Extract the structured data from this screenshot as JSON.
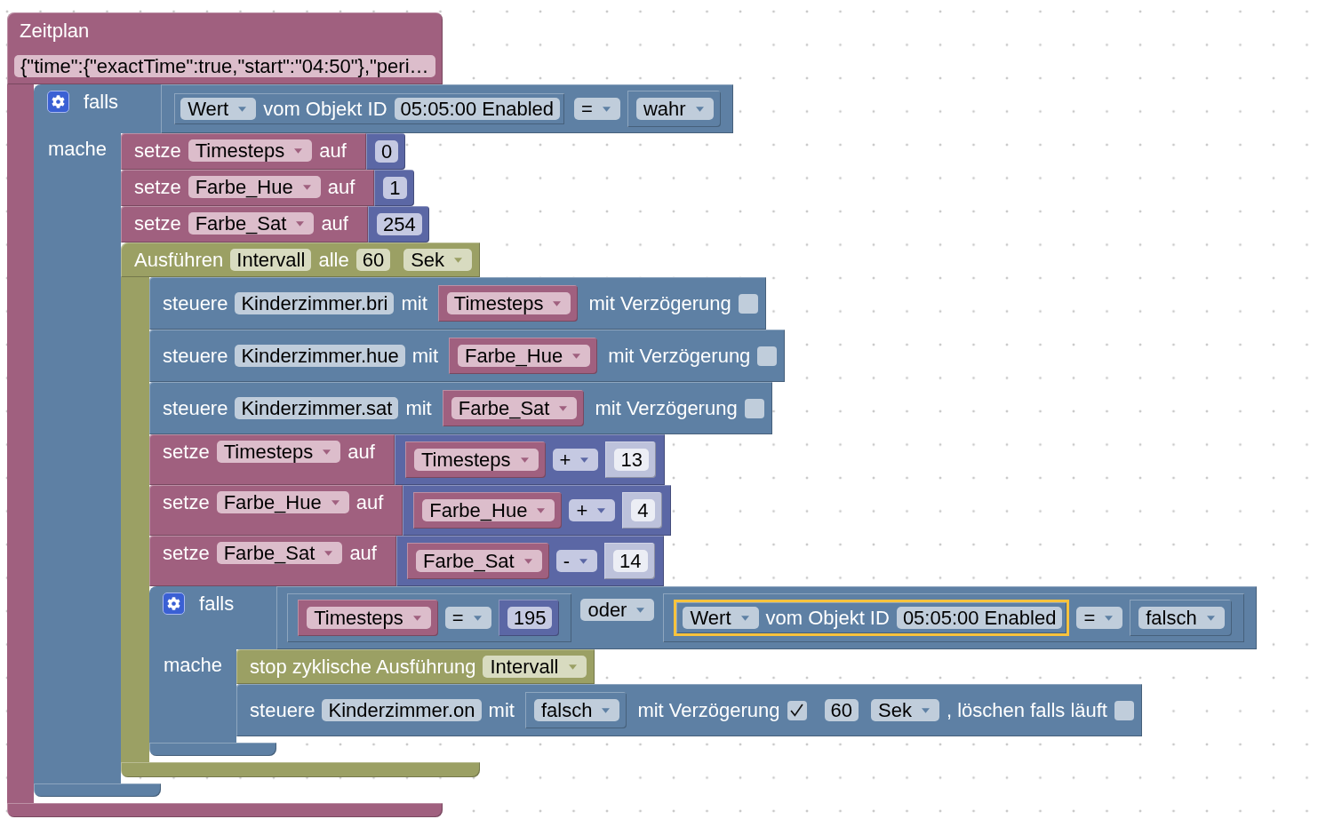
{
  "workspace": {
    "blocks": [
      {
        "kind": "schedule",
        "label": "Zeitplan",
        "schedule": "{\"time\":{\"exactTime\":true,\"start\":\"04:50\"},\"peri…",
        "statements": [
          {
            "kind": "if",
            "label": "falls",
            "do_label": "mache",
            "condition": {
              "kind": "compare",
              "a": {
                "kind": "get_value",
                "attribute": "Wert",
                "label": "vom Objekt ID",
                "object_id": "05:05:00 Enabled",
                "selected": false
              },
              "operator": "=",
              "b": {
                "kind": "boolean",
                "value": "wahr"
              }
            },
            "statements": [
              {
                "kind": "set_variable",
                "label": "setze",
                "variable": "Timesteps",
                "to_label": "auf",
                "value": {
                  "kind": "number",
                  "value": "0",
                  "shadow": false
                }
              },
              {
                "kind": "set_variable",
                "label": "setze",
                "variable": "Farbe_Hue",
                "to_label": "auf",
                "value": {
                  "kind": "number",
                  "value": "1",
                  "shadow": false
                }
              },
              {
                "kind": "set_variable",
                "label": "setze",
                "variable": "Farbe_Sat",
                "to_label": "auf",
                "value": {
                  "kind": "number",
                  "value": "254",
                  "shadow": false
                }
              },
              {
                "kind": "interval",
                "label": "Ausführen",
                "name": "Intervall",
                "every_label": "alle",
                "period": "60",
                "unit": "Sek",
                "statements": [
                  {
                    "kind": "control",
                    "label": "steuere",
                    "object_id": "Kinderzimmer.bri",
                    "with_label": "mit",
                    "value": {
                      "kind": "variable",
                      "name": "Timesteps"
                    },
                    "delay_label": "mit Verzögerung",
                    "delay": false
                  },
                  {
                    "kind": "control",
                    "label": "steuere",
                    "object_id": "Kinderzimmer.hue",
                    "with_label": "mit",
                    "value": {
                      "kind": "variable",
                      "name": "Farbe_Hue"
                    },
                    "delay_label": "mit Verzögerung",
                    "delay": false
                  },
                  {
                    "kind": "control",
                    "label": "steuere",
                    "object_id": "Kinderzimmer.sat",
                    "with_label": "mit",
                    "value": {
                      "kind": "variable",
                      "name": "Farbe_Sat"
                    },
                    "delay_label": "mit Verzögerung",
                    "delay": false
                  },
                  {
                    "kind": "set_variable",
                    "label": "setze",
                    "variable": "Timesteps",
                    "to_label": "auf",
                    "value": {
                      "kind": "arithmetic",
                      "a": {
                        "kind": "variable",
                        "name": "Timesteps"
                      },
                      "operator": "+",
                      "b": {
                        "kind": "number",
                        "value": "13",
                        "shadow": true
                      }
                    }
                  },
                  {
                    "kind": "set_variable",
                    "label": "setze",
                    "variable": "Farbe_Hue",
                    "to_label": "auf",
                    "value": {
                      "kind": "arithmetic",
                      "a": {
                        "kind": "variable",
                        "name": "Farbe_Hue"
                      },
                      "operator": "+",
                      "b": {
                        "kind": "number",
                        "value": "4",
                        "shadow": true
                      }
                    }
                  },
                  {
                    "kind": "set_variable",
                    "label": "setze",
                    "variable": "Farbe_Sat",
                    "to_label": "auf",
                    "value": {
                      "kind": "arithmetic",
                      "a": {
                        "kind": "variable",
                        "name": "Farbe_Sat"
                      },
                      "operator": "-",
                      "b": {
                        "kind": "number",
                        "value": "14",
                        "shadow": true
                      }
                    }
                  },
                  {
                    "kind": "if",
                    "label": "falls",
                    "do_label": "mache",
                    "condition": {
                      "kind": "logic_operation",
                      "a": {
                        "kind": "compare",
                        "a": {
                          "kind": "variable",
                          "name": "Timesteps"
                        },
                        "operator": "=",
                        "b": {
                          "kind": "number",
                          "value": "195",
                          "shadow": false
                        }
                      },
                      "operator": "oder",
                      "b": {
                        "kind": "compare",
                        "a": {
                          "kind": "get_value",
                          "attribute": "Wert",
                          "label": "vom Objekt ID",
                          "object_id": "05:05:00 Enabled",
                          "selected": true
                        },
                        "operator": "=",
                        "b": {
                          "kind": "boolean",
                          "value": "falsch"
                        }
                      }
                    },
                    "statements": [
                      {
                        "kind": "stop_interval",
                        "label": "stop zyklische Ausführung",
                        "name": "Intervall"
                      },
                      {
                        "kind": "control",
                        "label": "steuere",
                        "object_id": "Kinderzimmer.on",
                        "with_label": "mit",
                        "value": {
                          "kind": "boolean",
                          "value": "falsch"
                        },
                        "delay_label": "mit Verzögerung",
                        "delay": true,
                        "delay_value": "60",
                        "delay_unit": "Sek",
                        "clear_label": ", löschen falls läuft",
                        "clear_running": false
                      }
                    ]
                  }
                ]
              }
            ]
          }
        ]
      }
    ]
  }
}
